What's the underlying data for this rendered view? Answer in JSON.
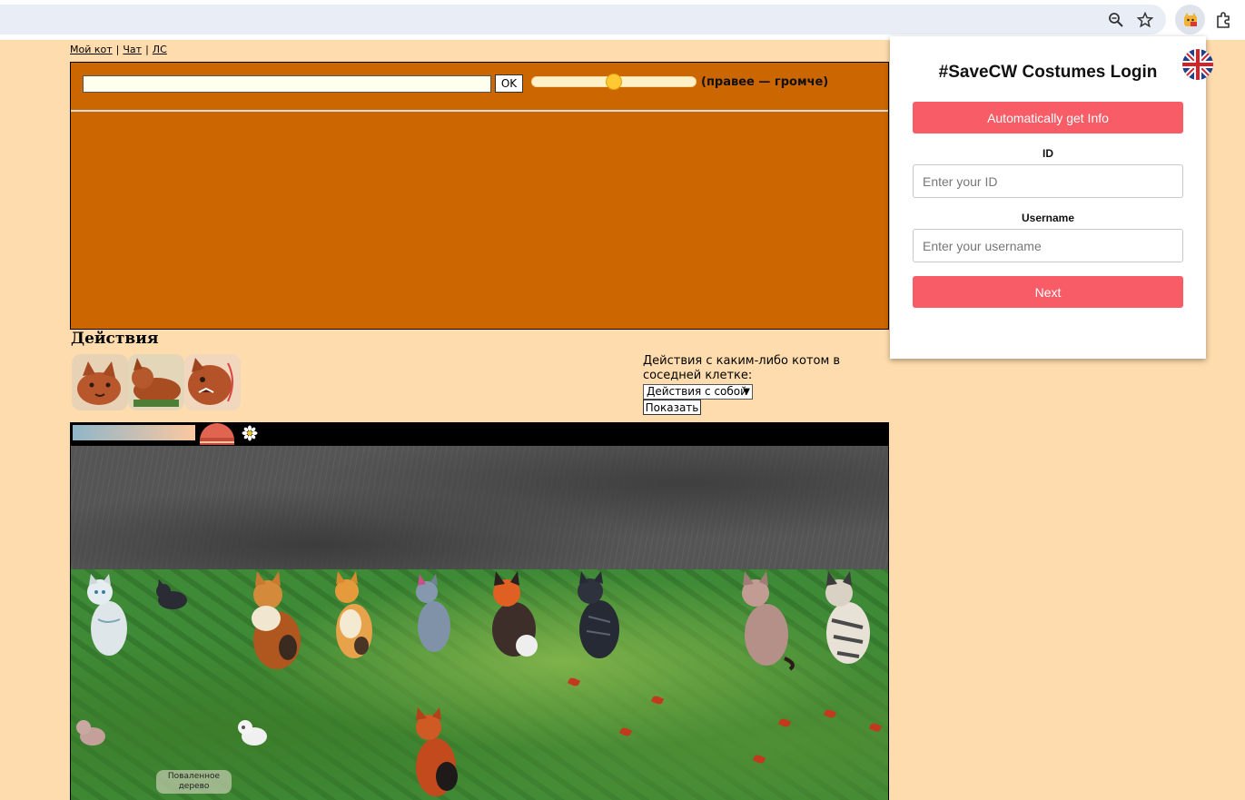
{
  "nav": {
    "links": [
      "Мой кот",
      "Чат",
      "ЛС"
    ],
    "separator": "|"
  },
  "chat": {
    "input_value": "",
    "ok_label": "OK",
    "volume_level": 0.5,
    "volume_hint": "(правее — громче)"
  },
  "actions": {
    "title": "Действия",
    "icons": [
      "cat-sniff-icon",
      "cat-crouch-icon",
      "cat-hiss-icon"
    ],
    "neighbor_label": "Действия с каким-либо котом в соседней клетке:",
    "select_value": "Действия с собой",
    "show_label": "Показать"
  },
  "location": {
    "object_label": "Поваленное дерево"
  },
  "colors": {
    "page_bg": "#fedcad",
    "chat_bg": "#cc6600",
    "popup_button": "#f85c66"
  },
  "popup": {
    "title": "#SaveCW Costumes Login",
    "auto_label": "Automatically get Info",
    "id_label": "ID",
    "id_placeholder": "Enter your ID",
    "username_label": "Username",
    "username_placeholder": "Enter your username",
    "next_label": "Next",
    "language_icon": "uk-flag-icon"
  },
  "browser": {
    "icons": [
      "zoom-icon",
      "bookmark-star-icon",
      "extension-cat-icon",
      "extensions-puzzle-icon"
    ]
  }
}
